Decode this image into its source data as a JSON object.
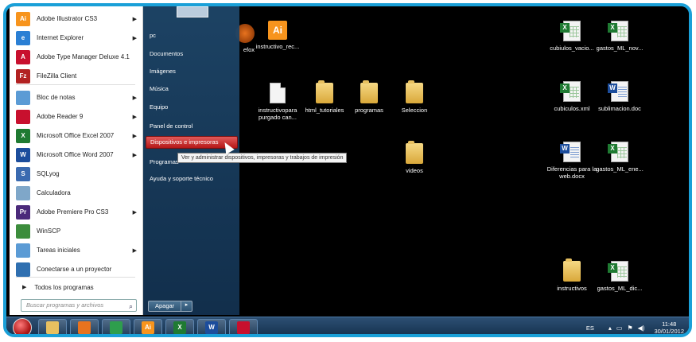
{
  "start_menu": {
    "programs": [
      {
        "label": "Adobe Illustrator CS3",
        "icon": "illustrator-icon",
        "abbr": "Ai",
        "color": "#f7941d",
        "arrow": true
      },
      {
        "label": "Internet Explorer",
        "icon": "internet-explorer-icon",
        "abbr": "e",
        "color": "#2a7fd4",
        "arrow": true
      },
      {
        "label": "Adobe Type Manager Deluxe 4.1",
        "icon": "adobe-type-manager-icon",
        "abbr": "A",
        "color": "#c8102e",
        "arrow": false
      },
      {
        "label": "FileZilla Client",
        "icon": "filezilla-icon",
        "abbr": "Fz",
        "color": "#b22222",
        "arrow": false
      },
      {
        "label": "Bloc de notas",
        "icon": "notepad-icon",
        "abbr": "",
        "color": "#5b9bd5",
        "arrow": true
      },
      {
        "label": "Adobe Reader 9",
        "icon": "adobe-reader-icon",
        "abbr": "",
        "color": "#c8102e",
        "arrow": true
      },
      {
        "label": "Microsoft Office Excel 2007",
        "icon": "excel-icon",
        "abbr": "X",
        "color": "#1f7a32",
        "arrow": true
      },
      {
        "label": "Microsoft Office Word 2007",
        "icon": "word-icon",
        "abbr": "W",
        "color": "#1c4d9c",
        "arrow": true
      },
      {
        "label": "SQLyog",
        "icon": "sqlyog-icon",
        "abbr": "S",
        "color": "#3a6ab0",
        "arrow": false
      },
      {
        "label": "Calculadora",
        "icon": "calculator-icon",
        "abbr": "",
        "color": "#7fa7c9",
        "arrow": false
      },
      {
        "label": "Adobe Premiere Pro CS3",
        "icon": "premiere-icon",
        "abbr": "Pr",
        "color": "#4b2a7a",
        "arrow": true
      },
      {
        "label": "WinSCP",
        "icon": "winscp-icon",
        "abbr": "",
        "color": "#3c8d3c",
        "arrow": false
      },
      {
        "label": "Tareas iniciales",
        "icon": "getting-started-icon",
        "abbr": "",
        "color": "#5b9bd5",
        "arrow": true
      },
      {
        "label": "Conectarse a un proyector",
        "icon": "projector-icon",
        "abbr": "",
        "color": "#2f6fb0",
        "arrow": false
      }
    ],
    "all_programs": "Todos los programas",
    "search_placeholder": "Buscar programas y archivos",
    "right_links": [
      "pc",
      "Documentos",
      "Imágenes",
      "Música",
      "Equipo",
      "Panel de control",
      "Dispositivos e impresoras",
      "Programas",
      "Ayuda y soporte técnico"
    ],
    "highlighted_index": 6,
    "shutdown_label": "Apagar"
  },
  "tooltip": "Ver y administrar dispositivos, impresoras y trabajos de impresión",
  "desktop_icons": [
    {
      "label": "efox",
      "type": "partial"
    },
    {
      "label": "instructivo_rec...",
      "type": "ai"
    },
    {
      "label": "instructivopara purgado can...",
      "type": "doc"
    },
    {
      "label": "html_tutoriales",
      "type": "folder"
    },
    {
      "label": "programas",
      "type": "folder"
    },
    {
      "label": "Seleccion",
      "type": "folder"
    },
    {
      "label": "videos",
      "type": "folder"
    },
    {
      "label": "cubiulos_vacio...",
      "type": "xls"
    },
    {
      "label": "gastos_ML_nov...",
      "type": "xls"
    },
    {
      "label": "cubiculos.xml",
      "type": "xls"
    },
    {
      "label": "sublimacion.doc",
      "type": "wrd"
    },
    {
      "label": "Diferencias para la web.docx",
      "type": "wrd"
    },
    {
      "label": "gastos_ML_ene...",
      "type": "xls"
    },
    {
      "label": "instructivos",
      "type": "folder"
    },
    {
      "label": "gastos_ML_dic...",
      "type": "xls"
    }
  ],
  "taskbar": {
    "apps": [
      {
        "name": "explorer-taskbar-button",
        "icon": "folder-icon",
        "color": "#e7c060",
        "abbr": ""
      },
      {
        "name": "firefox-taskbar-button",
        "icon": "firefox-icon",
        "color": "#e8731e",
        "abbr": ""
      },
      {
        "name": "chrome-taskbar-button",
        "icon": "chrome-icon",
        "color": "#2e9e4d",
        "abbr": ""
      },
      {
        "name": "illustrator-taskbar-button",
        "icon": "illustrator-icon",
        "color": "#f7941d",
        "abbr": "Ai"
      },
      {
        "name": "excel-taskbar-button",
        "icon": "excel-icon",
        "color": "#1f7a32",
        "abbr": "X"
      },
      {
        "name": "word-taskbar-button",
        "icon": "word-icon",
        "color": "#1c4d9c",
        "abbr": "W"
      },
      {
        "name": "acrobat-taskbar-button",
        "icon": "acrobat-icon",
        "color": "#c8102e",
        "abbr": ""
      }
    ],
    "language": "ES",
    "time": "11:48",
    "date": "30/01/2012"
  }
}
